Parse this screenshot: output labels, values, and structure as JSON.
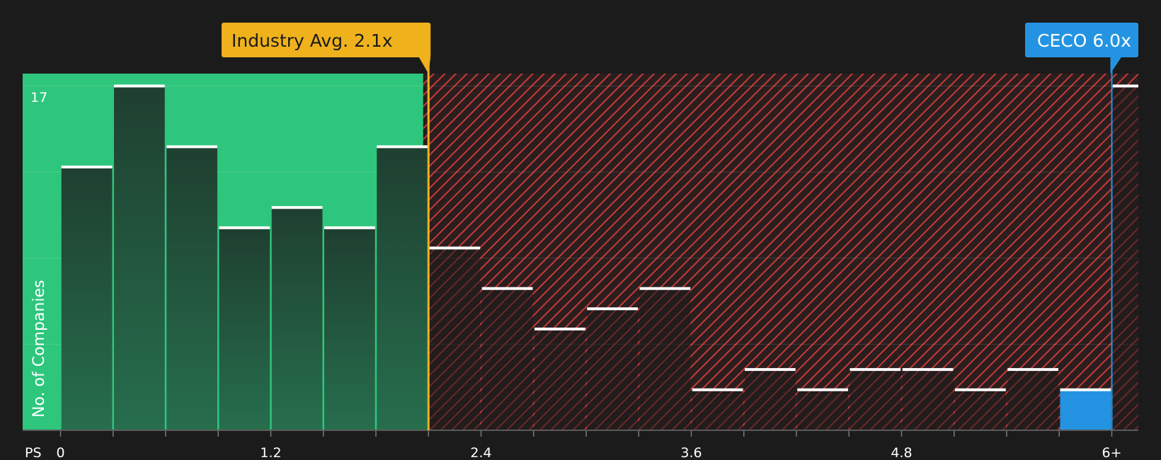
{
  "chart_data": {
    "type": "bar",
    "xlabel": "PS",
    "ylabel": "No. of Companies",
    "ylim": [
      0,
      17
    ],
    "ymax_label": "17",
    "x_tick_labels": [
      "0",
      "1.2",
      "2.4",
      "3.6",
      "4.8",
      "6+"
    ],
    "x_tick_values": [
      0,
      1.2,
      2.4,
      3.6,
      4.8,
      6
    ],
    "bin_width": 0.3,
    "bins": [
      {
        "start": 0.0,
        "value": 13
      },
      {
        "start": 0.3,
        "value": 17
      },
      {
        "start": 0.6,
        "value": 14
      },
      {
        "start": 0.9,
        "value": 10
      },
      {
        "start": 1.2,
        "value": 11
      },
      {
        "start": 1.5,
        "value": 10
      },
      {
        "start": 1.8,
        "value": 14
      },
      {
        "start": 2.1,
        "value": 9
      },
      {
        "start": 2.4,
        "value": 7
      },
      {
        "start": 2.7,
        "value": 5
      },
      {
        "start": 3.0,
        "value": 6
      },
      {
        "start": 3.3,
        "value": 7
      },
      {
        "start": 3.6,
        "value": 2
      },
      {
        "start": 3.9,
        "value": 3
      },
      {
        "start": 4.2,
        "value": 2
      },
      {
        "start": 4.5,
        "value": 3
      },
      {
        "start": 4.8,
        "value": 3
      },
      {
        "start": 5.1,
        "value": 2
      },
      {
        "start": 5.4,
        "value": 3
      },
      {
        "start": 5.7,
        "value": 2,
        "highlight": true
      },
      {
        "start": 6.0,
        "value": 17
      }
    ],
    "fair_range_max": 2.07,
    "industry_avg": {
      "label": "Industry Avg. 2.1x",
      "value": 2.1
    },
    "company": {
      "label": "CECO 6.0x",
      "value": 6.0
    },
    "grid": true,
    "colors": {
      "background": "#1b1b1b",
      "fair_zone": "#2ec67c",
      "overvalued_hatch": "#c73a3a",
      "bar_dark": "#23412f",
      "bar_cap": "#ffffff",
      "highlight_bar": "#2494e2",
      "industry": "#f0b21c",
      "company": "#2494e2"
    }
  }
}
